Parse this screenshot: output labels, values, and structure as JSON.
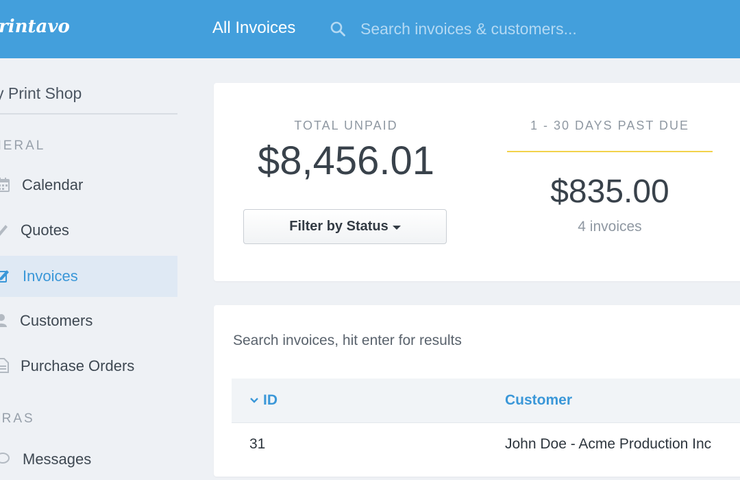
{
  "app": {
    "logo_text": "rintavo"
  },
  "header": {
    "nav_title": "All Invoices",
    "search_placeholder": "Search invoices & customers..."
  },
  "sidebar": {
    "shop_name": "y Print Shop",
    "sections": [
      {
        "label": "NERAL"
      },
      {
        "label": "TRAS"
      }
    ],
    "items": [
      {
        "label": "Calendar",
        "icon": "calendar-icon"
      },
      {
        "label": "Quotes",
        "icon": "pencil-icon"
      },
      {
        "label": "Invoices",
        "icon": "edit-icon",
        "active": true
      },
      {
        "label": "Customers",
        "icon": "user-icon"
      },
      {
        "label": "Purchase Orders",
        "icon": "document-icon"
      },
      {
        "label": "Messages",
        "icon": "chat-icon"
      }
    ]
  },
  "stats": {
    "total_unpaid": {
      "label": "TOTAL UNPAID",
      "value": "$8,456.01"
    },
    "past_due": {
      "label": "1 - 30 DAYS PAST DUE",
      "value": "$835.00",
      "count": "4 invoices"
    },
    "filter_label": "Filter by Status"
  },
  "table": {
    "search_placeholder": "Search invoices, hit enter for results",
    "columns": [
      "ID",
      "Customer"
    ],
    "rows": [
      {
        "id": "31",
        "customer": "John Doe - Acme Production Inc"
      }
    ]
  },
  "colors": {
    "brand": "#439fdc",
    "accent": "#3a97d8",
    "past_due_rule": "#f2d24a"
  }
}
